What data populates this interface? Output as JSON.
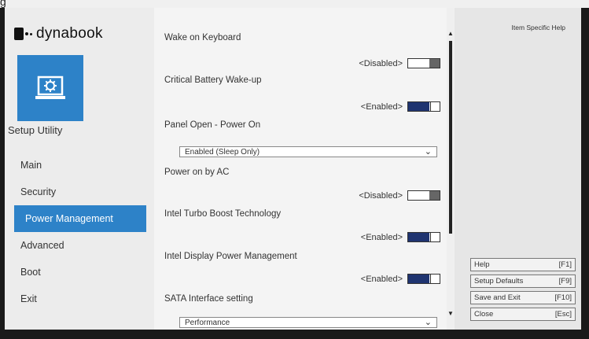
{
  "bezel": {
    "top_text": "g"
  },
  "brand": {
    "logo_text": "dynabook"
  },
  "sidebar": {
    "setup_label": "Setup Utility",
    "items": [
      {
        "label": "Main",
        "active": false
      },
      {
        "label": "Security",
        "active": false
      },
      {
        "label": "Power Management",
        "active": true
      },
      {
        "label": "Advanced",
        "active": false
      },
      {
        "label": "Boot",
        "active": false
      },
      {
        "label": "Exit",
        "active": false
      }
    ]
  },
  "settings": {
    "wake_on_keyboard": {
      "label": "Wake on Keyboard",
      "value": "<Disabled>"
    },
    "critical_battery": {
      "label": "Critical Battery Wake-up",
      "value": "<Enabled>"
    },
    "panel_open": {
      "label": "Panel Open - Power On",
      "value": "Enabled (Sleep Only)"
    },
    "power_on_ac": {
      "label": "Power on by AC",
      "value": "<Disabled>"
    },
    "turbo_boost": {
      "label": "Intel Turbo Boost Technology",
      "value": "<Enabled>"
    },
    "display_power": {
      "label": "Intel Display Power Management",
      "value": "<Enabled>"
    },
    "sata": {
      "label": "SATA Interface setting",
      "value": "Performance"
    }
  },
  "help": {
    "title": "Item Specific Help",
    "keys": [
      {
        "label": "Help",
        "key": "[F1]"
      },
      {
        "label": "Setup Defaults",
        "key": "[F9]"
      },
      {
        "label": "Save and Exit",
        "key": "[F10]"
      },
      {
        "label": "Close",
        "key": "[Esc]"
      }
    ]
  },
  "icons": {
    "logo": "dynabook-logo-icon",
    "setup": "laptop-gear-icon",
    "dropdown": "chevron-down-icon",
    "scroll_up": "arrow-up-icon",
    "scroll_down": "arrow-down-icon"
  },
  "colors": {
    "accent": "#2d82c8",
    "toggle_on": "#1f3470"
  }
}
